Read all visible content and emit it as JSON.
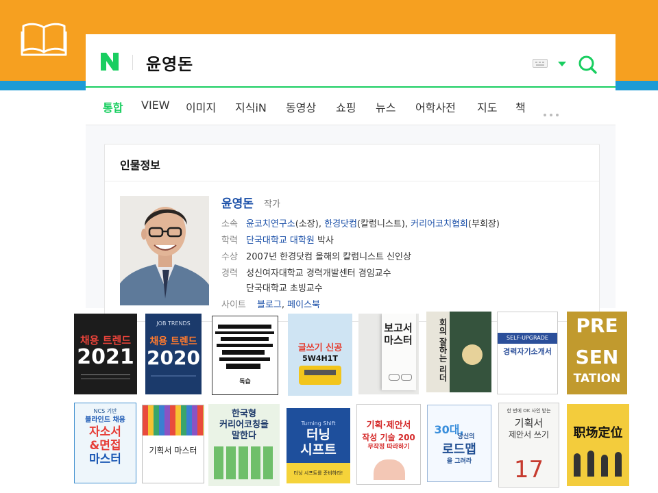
{
  "search": {
    "query": "윤영돈",
    "tabs": [
      "통합",
      "VIEW",
      "이미지",
      "지식iN",
      "동영상",
      "쇼핑",
      "뉴스",
      "어학사전",
      "지도",
      "책"
    ]
  },
  "profile": {
    "card_title": "인물정보",
    "name": "윤영돈",
    "job": "작가",
    "labels": {
      "affiliation": "소속",
      "education": "학력",
      "award": "수상",
      "career": "경력",
      "site": "사이트"
    },
    "affiliation": {
      "org1": "윤코치연구소",
      "role1": "(소장), ",
      "org2": "한경닷컴",
      "role2": "(칼럼니스트), ",
      "org3": "커리어코치협회",
      "role3": "(부회장)"
    },
    "education": {
      "school": "단국대학교 대학원",
      "degree": " 박사"
    },
    "award": "2007년 한경닷컴 올해의 칼럼니스트 신인상",
    "career": [
      "성신여자대학교 경력개발센터 겸임교수",
      "단국대학교 초빙교수"
    ],
    "sites": {
      "blog": "블로그",
      "sep": ", ",
      "facebook": "페이스북"
    }
  },
  "books": {
    "b1": {
      "top": "채용 트렌드",
      "big": "2021"
    },
    "b2": {
      "small": "JOB TRENDS",
      "top": "채용 트렌드",
      "big": "2020"
    },
    "b3": {
      "title": "독습"
    },
    "b4": {
      "line1": "글쓰기 신공",
      "line2": "5W4H1T"
    },
    "b5": {
      "line1": "보고서",
      "line2": "마스터"
    },
    "b6": {
      "title": "회의 잘하는 리더"
    },
    "b7": {
      "top": "SELF-UPGRADE",
      "title": "경력자기소개서"
    },
    "b8": {
      "l1": "PRE",
      "l2": "SEN",
      "l3": "TATION"
    },
    "b9": {
      "l0": "NCS 기반",
      "l1": "블라인드 채용",
      "l2": "자소서",
      "l3": "&면접",
      "l4": "마스터"
    },
    "b10": {
      "title": "기획서 마스터"
    },
    "b11": {
      "line1": "한국형",
      "line2": "커리어코칭을",
      "line3": "말한다"
    },
    "b12": {
      "small": "Turning Shift",
      "title": "터닝",
      "title2": "시프트",
      "sub": "터닝 시프트를 준비하라!"
    },
    "b13": {
      "line1": "기획·제안서",
      "line2": "작성 기술 200",
      "line3": "무작정 따라하기"
    },
    "b14": {
      "big": "30대,",
      "line1": "당신의",
      "line2": "로드맵",
      "line3": "을 그려라"
    },
    "b15": {
      "top": "한 번에 OK 사인 받는",
      "line1": "기획서",
      "line2": "제안서 쓰기",
      "num": "17"
    },
    "b16": {
      "title": "职场定位"
    }
  }
}
